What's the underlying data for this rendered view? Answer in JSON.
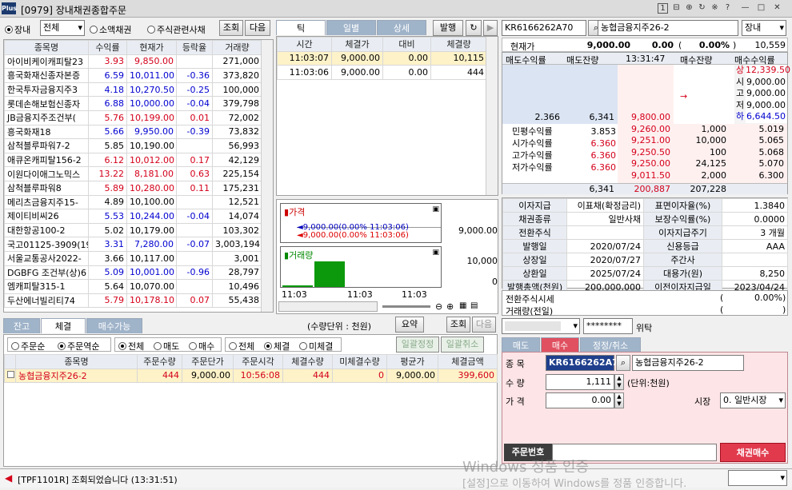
{
  "window": {
    "logo": "Plus",
    "title": "[0979] 장내채권종합주문",
    "icons": [
      "1",
      "⊟",
      "⊕",
      "↻",
      "※",
      "?",
      "—",
      "□",
      "✕"
    ]
  },
  "left": {
    "radio_label": "장내",
    "market_select": "전체",
    "radio2": "소액채권",
    "radio3": "주식관련사채",
    "query_btn": "조회",
    "next_btn": "다음",
    "headers": [
      "종목명",
      "수익률",
      "현재가",
      "등락율",
      "거래량"
    ],
    "rows": [
      {
        "name": "아이비케이캐피탈23",
        "yld": "3.93",
        "price": "9,850.00",
        "chg": "",
        "vol": "271,000",
        "c": "red",
        "cc": ""
      },
      {
        "name": "흥국화재신종자본증",
        "yld": "6.59",
        "price": "10,011.00",
        "chg": "-0.36",
        "vol": "373,820",
        "c": "blue",
        "cc": "blue"
      },
      {
        "name": "한국투자금융지주3",
        "yld": "4.18",
        "price": "10,270.50",
        "chg": "-0.25",
        "vol": "100,000",
        "c": "blue",
        "cc": "blue"
      },
      {
        "name": "롯데손해보험신종자",
        "yld": "6.88",
        "price": "10,000.00",
        "chg": "-0.04",
        "vol": "379,798",
        "c": "blue",
        "cc": "blue"
      },
      {
        "name": "JB금융지주조건부(",
        "yld": "5.76",
        "price": "10,199.00",
        "chg": "0.01",
        "vol": "72,002",
        "c": "red",
        "cc": "red"
      },
      {
        "name": "흥국화재18",
        "yld": "5.66",
        "price": "9,950.00",
        "chg": "-0.39",
        "vol": "73,832",
        "c": "blue",
        "cc": "blue"
      },
      {
        "name": "삼척블루파워7-2",
        "yld": "5.85",
        "price": "10,190.00",
        "chg": "",
        "vol": "56,993",
        "c": "",
        "cc": ""
      },
      {
        "name": "애큐온캐피탈156-2",
        "yld": "6.12",
        "price": "10,012.00",
        "chg": "0.17",
        "vol": "42,129",
        "c": "red",
        "cc": "red"
      },
      {
        "name": "이원다이애그노믹스",
        "yld": "13.22",
        "price": "8,181.00",
        "chg": "0.63",
        "vol": "225,154",
        "c": "red",
        "cc": "red"
      },
      {
        "name": "삼척블루파워8",
        "yld": "5.89",
        "price": "10,280.00",
        "chg": "0.11",
        "vol": "175,231",
        "c": "red",
        "cc": "red"
      },
      {
        "name": "메리츠금융지주15-",
        "yld": "4.89",
        "price": "10,100.00",
        "chg": "",
        "vol": "12,521",
        "c": "",
        "cc": ""
      },
      {
        "name": "제이티비씨26",
        "yld": "5.53",
        "price": "10,244.00",
        "chg": "-0.04",
        "vol": "14,074",
        "c": "blue",
        "cc": "blue"
      },
      {
        "name": "대한항공100-2",
        "yld": "5.02",
        "price": "10,179.00",
        "chg": "",
        "vol": "103,302",
        "c": "",
        "cc": ""
      },
      {
        "name": "국고01125-3909(19",
        "yld": "3.31",
        "price": "7,280.00",
        "chg": "-0.07",
        "vol": "3,003,194",
        "c": "blue",
        "cc": "blue"
      },
      {
        "name": "서울교통공사2022-",
        "yld": "3.66",
        "price": "10,117.00",
        "chg": "",
        "vol": "3,001",
        "c": "",
        "cc": ""
      },
      {
        "name": "DGBFG 조건부(상)6",
        "yld": "5.09",
        "price": "10,001.00",
        "chg": "-0.96",
        "vol": "28,797",
        "c": "blue",
        "cc": "blue"
      },
      {
        "name": "엠캐피탈315-1",
        "yld": "5.64",
        "price": "10,070.00",
        "chg": "",
        "vol": "10,496",
        "c": "",
        "cc": ""
      },
      {
        "name": "두산에너빌리티74",
        "yld": "5.79",
        "price": "10,178.10",
        "chg": "0.07",
        "vol": "55,438",
        "c": "red",
        "cc": "red"
      }
    ]
  },
  "tick": {
    "tabs": [
      "틱",
      "일별",
      "상세"
    ],
    "issue_btn": "발행",
    "headers": [
      "시간",
      "체결가",
      "대비",
      "체결량"
    ],
    "rows": [
      {
        "time": "11:03:07",
        "price": "9,000.00",
        "diff": "0.00",
        "qty": "10,115"
      },
      {
        "time": "11:03:06",
        "price": "9,000.00",
        "diff": "0.00",
        "qty": "444"
      }
    ]
  },
  "chart": {
    "price_label": "가격",
    "legend1": "9,000.00(0.00% 11:03:06)",
    "legend2": "9,000.00(0.00% 11:03:06)",
    "y_price": "9,000.00",
    "volume_label": "거래량",
    "y_vol_top": "10,000",
    "y_vol_bottom": "0",
    "x_labels": [
      "11:03",
      "11:03",
      "11:03"
    ]
  },
  "quote": {
    "code": "KR6166262A70",
    "name": "농협금융지주26-2",
    "market": "장내",
    "cur_label": "현재가",
    "cur_price": "9,000.00",
    "diff": "0.00",
    "pct": "0.00%",
    "vol": "10,559",
    "headers": [
      "매도수익률",
      "매도잔량",
      "13:31:47",
      "매수잔량",
      "매수수익률"
    ],
    "sell_yld": "2.366",
    "sell_qty": "6,341",
    "sell_price": "9,800.00",
    "arrow": "→",
    "side_labels": [
      "상",
      "시",
      "고",
      "저",
      "하"
    ],
    "side_values": [
      "12,339.50",
      "9,000.00",
      "9,000.00",
      "9,000.00",
      "6,644.50"
    ],
    "yield_labels": [
      "민평수익률",
      "시가수익률",
      "고가수익률",
      "저가수익률"
    ],
    "yield_values": [
      "3.853",
      "6.360",
      "6.360",
      "6.360"
    ],
    "bids": [
      {
        "price": "9,260.00",
        "qty": "1,000",
        "yld": "5.019"
      },
      {
        "price": "9,251.00",
        "qty": "10,000",
        "yld": "5.065"
      },
      {
        "price": "9,250.50",
        "qty": "100",
        "yld": "5.068"
      },
      {
        "price": "9,250.00",
        "qty": "24,125",
        "yld": "5.070"
      },
      {
        "price": "9,011.50",
        "qty": "2,000",
        "yld": "6.300"
      }
    ],
    "tot_sell": "6,341",
    "tot_mid": "200,887",
    "tot_buy": "207,228"
  },
  "info": {
    "rows": [
      {
        "l1": "이자지급",
        "v1": "이표채(확정금리)",
        "l2": "표면이자율(%)",
        "v2": "1.3840"
      },
      {
        "l1": "채권종류",
        "v1": "일반사채",
        "l2": "보장수익률(%)",
        "v2": "0.0000"
      },
      {
        "l1": "전환주식",
        "v1": "",
        "l2": "이자지급주기",
        "v2": "3 개월"
      },
      {
        "l1": "발행일",
        "v1": "2020/07/24",
        "l2": "신용등급",
        "v2": "AAA"
      },
      {
        "l1": "상장일",
        "v1": "2020/07/27",
        "l2": "주간사",
        "v2": ""
      },
      {
        "l1": "상환일",
        "v1": "2025/07/24",
        "l2": "대용가(원)",
        "v2": "8,250"
      },
      {
        "l1": "발행총액(천원)",
        "v1": "200,000,000",
        "l2": "이전이자지급일",
        "v2": "2023/04/24"
      }
    ],
    "conv_label": "전환주식시세",
    "conv_pct": "0.00%",
    "prev_label": "거래량(전일)"
  },
  "account": {
    "password": "********",
    "delegate": "위탁"
  },
  "order": {
    "tabs": [
      "매도",
      "매수",
      "정정/취소"
    ],
    "code_label": "종 목",
    "code": "KR6166262A70",
    "name": "농협금융지주26-2",
    "qty_label": "수 량",
    "qty": "1,111",
    "unit": "(단위:천원)",
    "price_label": "가 격",
    "price": "0.00",
    "market_label": "시장",
    "market": "0. 일반시장",
    "order_no_label": "주문번호",
    "submit": "채권매수"
  },
  "bottom": {
    "tabs": [
      "잔고",
      "체결",
      "매수가능"
    ],
    "unit_note": "(수량단위 : 천원)",
    "summary_btn": "요약",
    "query_btn": "조회",
    "next_btn": "다음",
    "sort1": "주문순",
    "sort2": "주문역순",
    "f_all": "전체",
    "f_sell": "매도",
    "f_buy": "매수",
    "f2_all": "전체",
    "f2_done": "체결",
    "f2_undone": "미체결",
    "bulk_edit": "일괄정정",
    "bulk_cancel": "일괄취소",
    "headers": [
      "종목명",
      "주문수량",
      "주문단가",
      "주문시각",
      "체결수량",
      "미체결수량",
      "평균가",
      "체결금액"
    ],
    "rows": [
      {
        "name": "농협금융지주26-2",
        "qty": "444",
        "price": "9,000.00",
        "time": "10:56:08",
        "done": "444",
        "undone": "0",
        "avg": "9,000.00",
        "amt": "399,600"
      }
    ]
  },
  "status": {
    "message": "[TPF1101R] 조회되었습니다 (13:31:51)"
  },
  "watermark": {
    "line1": "Windows 정품 인증",
    "line2": "[설정]으로 이동하여 Windows를 정품 인증합니다."
  }
}
